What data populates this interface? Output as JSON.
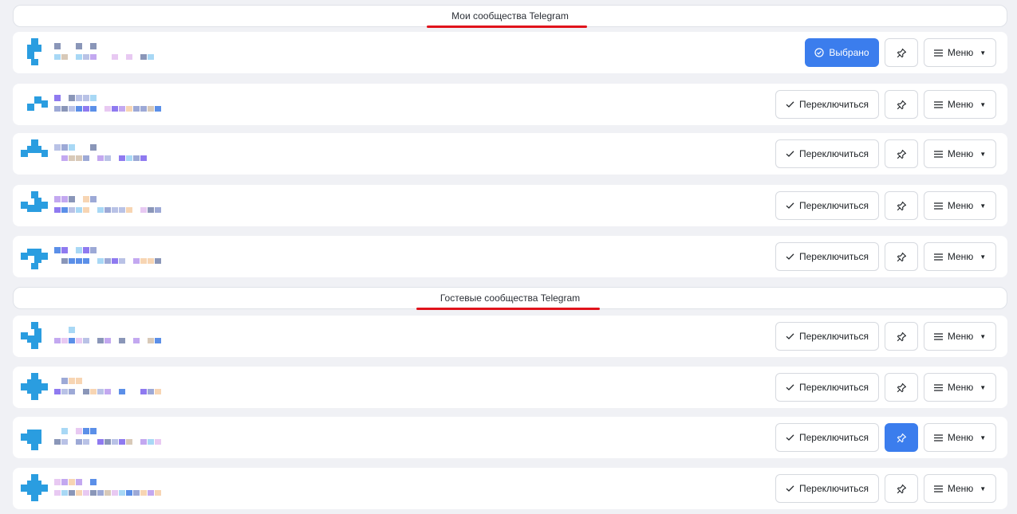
{
  "sections": {
    "my": {
      "title": "Мои сообщества Telegram"
    },
    "guest": {
      "title": "Гостевые сообщества Telegram"
    }
  },
  "labels": {
    "selected": "Выбрано",
    "switch": "Переключиться",
    "menu": "Меню"
  },
  "colors": {
    "accent": "#3b7ded",
    "underline": "#e0131b",
    "avatar": "#2a9de0"
  },
  "icons": {
    "selected": "check-circle-icon",
    "switch": "check-icon",
    "pin": "pin-icon",
    "menu": "hamburger-icon",
    "caret": "caret-down-icon"
  },
  "communities": [
    {
      "group": "my",
      "state": "selected",
      "pinned": false
    },
    {
      "group": "my",
      "state": "switch",
      "pinned": false
    },
    {
      "group": "my",
      "state": "switch",
      "pinned": false
    },
    {
      "group": "my",
      "state": "switch",
      "pinned": false
    },
    {
      "group": "my",
      "state": "switch",
      "pinned": false
    },
    {
      "group": "guest",
      "state": "switch",
      "pinned": false
    },
    {
      "group": "guest",
      "state": "switch",
      "pinned": false
    },
    {
      "group": "guest",
      "state": "switch",
      "pinned": true
    },
    {
      "group": "guest",
      "state": "switch",
      "pinned": false
    }
  ]
}
